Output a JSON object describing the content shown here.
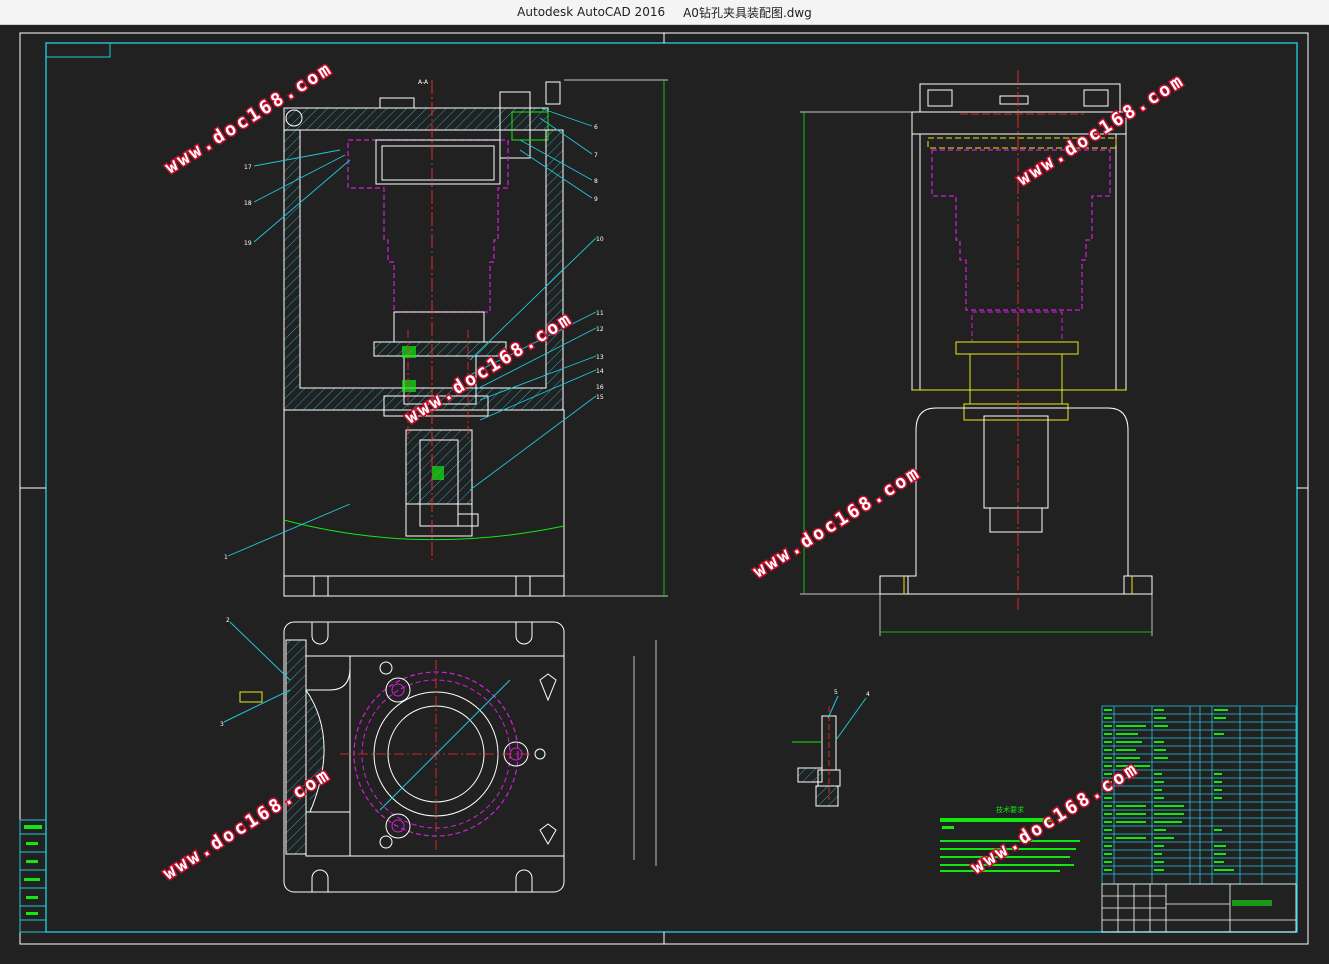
{
  "window": {
    "app_name": "Autodesk AutoCAD 2016",
    "file_name": "A0钻孔夹具装配图.dwg"
  },
  "drawing": {
    "section_label": "A-A",
    "balloons_left": [
      "6",
      "7",
      "8",
      "9",
      "10",
      "11",
      "12",
      "13",
      "14",
      "15",
      "16",
      "17",
      "18",
      "19",
      "1"
    ],
    "balloons_plan": [
      "2",
      "3"
    ],
    "balloons_detail": [
      "5",
      "4"
    ],
    "tech_requirements_title": "技术要求",
    "watermark": "www.doc168.com",
    "colors": {
      "background": "#212121",
      "geometry": "#ffffff",
      "frame": "#22c5d8",
      "hidden_lines": "#d21fd6",
      "centerlines": "#ff2a2a",
      "hatch": "#22c5d8",
      "yellow": "#e9e91a",
      "green": "#13e613",
      "watermark_stroke": "#c8102e"
    }
  }
}
